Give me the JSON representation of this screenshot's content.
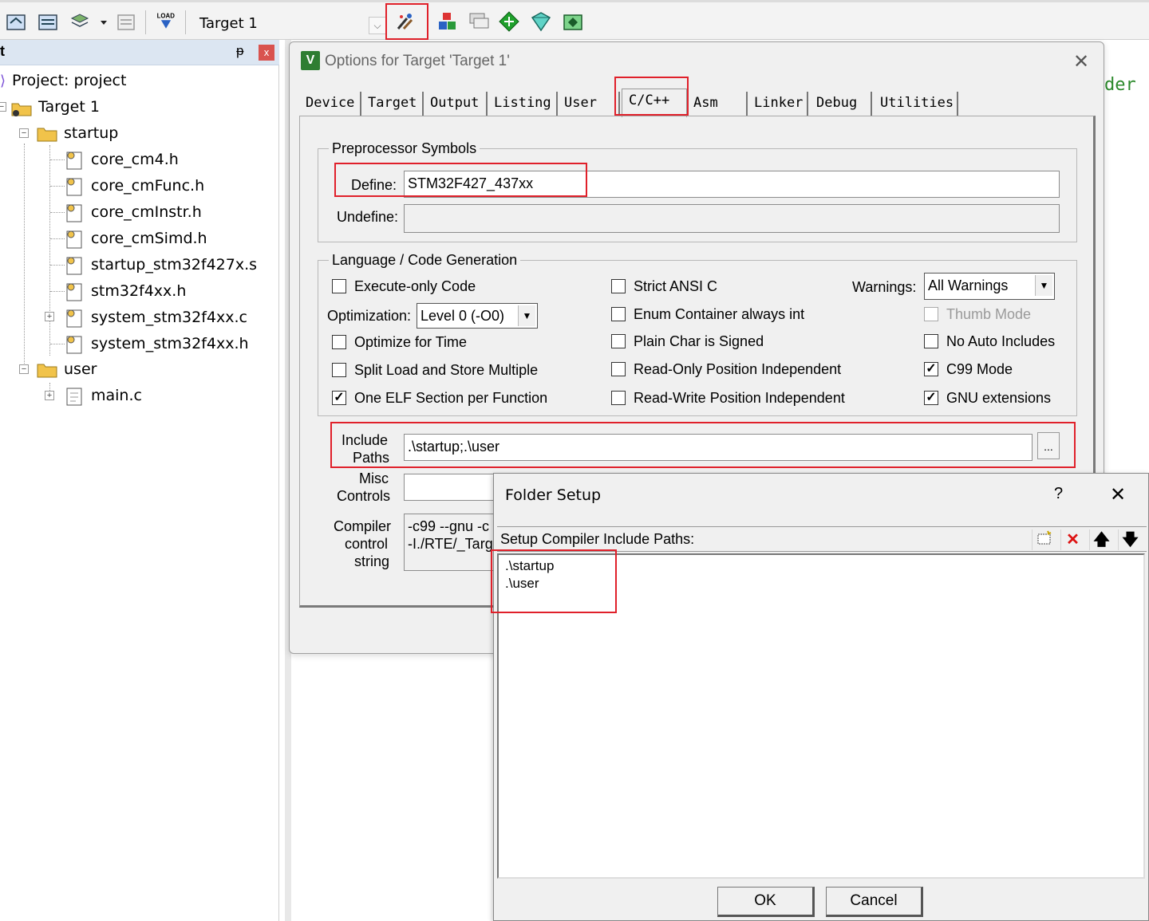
{
  "toolbar": {
    "target_name": "Target 1",
    "load_label": "LOAD"
  },
  "project_panel": {
    "title": "t",
    "pin": "ᵽ",
    "close": "x",
    "project_label": "Project: project",
    "target_label": "Target 1",
    "groups": [
      {
        "name": "startup",
        "files": [
          "core_cm4.h",
          "core_cmFunc.h",
          "core_cmInstr.h",
          "core_cmSimd.h",
          "startup_stm32f427x.s",
          "stm32f4xx.h",
          "system_stm32f4xx.c",
          "system_stm32f4xx.h"
        ]
      },
      {
        "name": "user",
        "files": [
          "main.c"
        ]
      }
    ]
  },
  "editor": {
    "visible_text": "der"
  },
  "options_dialog": {
    "title": "Options for Target 'Target 1'",
    "logo": "V",
    "tabs": [
      "Device",
      "Target",
      "Output",
      "Listing",
      "User",
      "C/C++",
      "Asm",
      "Linker",
      "Debug",
      "Utilities"
    ],
    "active_tab": "C/C++",
    "preprocessor": {
      "group_label": "Preprocessor Symbols",
      "define_label": "Define:",
      "define_value": "STM32F427_437xx",
      "undefine_label": "Undefine:",
      "undefine_value": ""
    },
    "codegen": {
      "group_label": "Language / Code Generation",
      "execute_only": {
        "label": "Execute-only Code",
        "checked": false
      },
      "optimization_label": "Optimization:",
      "optimization_value": "Level 0 (-O0)",
      "optimize_time": {
        "label": "Optimize for Time",
        "checked": false
      },
      "split_load": {
        "label": "Split Load and Store Multiple",
        "checked": false
      },
      "one_elf": {
        "label": "One ELF Section per Function",
        "checked": true
      },
      "strict_ansi": {
        "label": "Strict ANSI C",
        "checked": false
      },
      "enum_container": {
        "label": "Enum Container always int",
        "checked": false
      },
      "plain_char": {
        "label": "Plain Char is Signed",
        "checked": false
      },
      "ropi": {
        "label": "Read-Only Position Independent",
        "checked": false
      },
      "rwpi": {
        "label": "Read-Write Position Independent",
        "checked": false
      },
      "warnings_label": "Warnings:",
      "warnings_value": "All Warnings",
      "thumb_mode": {
        "label": "Thumb Mode",
        "checked": false,
        "disabled": true
      },
      "no_auto_includes": {
        "label": "No Auto Includes",
        "checked": false
      },
      "c99_mode": {
        "label": "C99 Mode",
        "checked": true
      },
      "gnu_extensions": {
        "label": "GNU extensions",
        "checked": true
      },
      "check_glyph": "✓"
    },
    "include_paths_label_1": "Include",
    "include_paths_label_2": "Paths",
    "include_paths_value": ".\\startup;.\\user",
    "browse_label": "...",
    "misc_label_1": "Misc",
    "misc_label_2": "Controls",
    "misc_value": "",
    "compiler_label_1": "Compiler",
    "compiler_label_2": "control",
    "compiler_label_3": "string",
    "compiler_line_1": "-c99 --gnu -c",
    "compiler_line_2": "-I./RTE/_Targ"
  },
  "folder_setup": {
    "title": "Folder Setup",
    "help": "?",
    "close": "✕",
    "caption": "Setup Compiler Include Paths:",
    "paths": [
      ".\\startup",
      ".\\user"
    ],
    "ok_label": "OK",
    "cancel_label": "Cancel"
  },
  "colors": {
    "highlight": "#e0202a",
    "panel_header": "#dce6f2",
    "dialog_bg": "#f0f0f0"
  }
}
